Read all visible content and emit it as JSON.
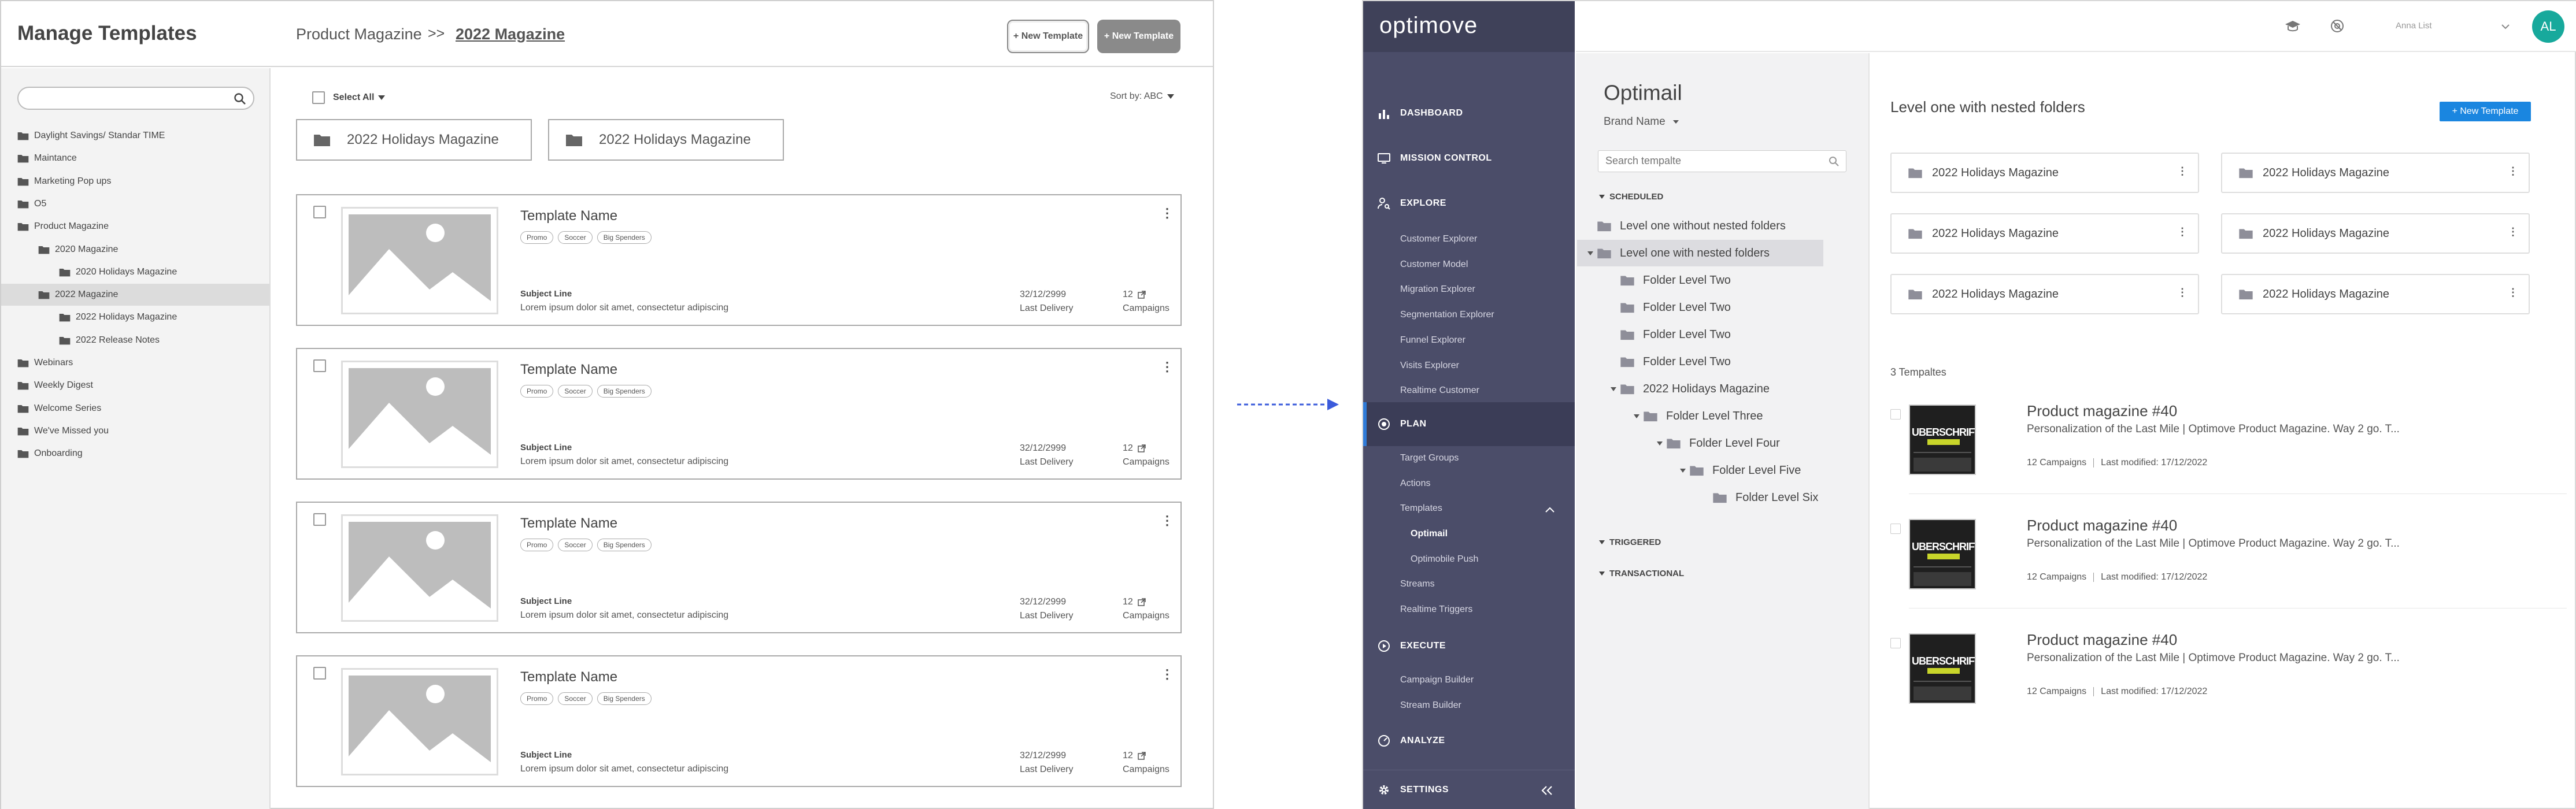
{
  "wireframe": {
    "title": "Manage Templates",
    "breadcrumb": {
      "parent": "Product Magazine",
      "separator": ">>",
      "current": "2022 Magazine"
    },
    "buttons": {
      "new_template_outline": "+ New Template",
      "new_template_filled": "+ New Template"
    },
    "tree": [
      {
        "label": "Daylight Savings/ Standar TIME"
      },
      {
        "label": "Maintance"
      },
      {
        "label": "Marketing Pop ups"
      },
      {
        "label": "O5"
      },
      {
        "label": "Product Magazine"
      },
      {
        "label": "2020 Magazine"
      },
      {
        "label": "2020 Holidays Magazine"
      },
      {
        "label": "2022 Magazine"
      },
      {
        "label": "2022 Holidays Magazine"
      },
      {
        "label": "2022 Release Notes"
      },
      {
        "label": "Webinars"
      },
      {
        "label": "Weekly Digest"
      },
      {
        "label": "Welcome Series"
      },
      {
        "label": "We've Missed you"
      },
      {
        "label": "Onboarding"
      }
    ],
    "select_all": "Select All",
    "sort_by": "Sort by: ABC",
    "folders": [
      "2022 Holidays Magazine",
      "2022 Holidays Magazine"
    ],
    "cards": [
      {
        "name": "Template Name",
        "tags": [
          "Promo",
          "Soccer",
          "Big Spenders"
        ],
        "subject_label": "Subject Line",
        "body": "Lorem ipsum dolor sit amet, consectetur adipiscing",
        "date": "32/12/2999",
        "date_label": "Last Delivery",
        "count": "12",
        "count_label": "Campaigns"
      },
      {
        "name": "Template Name",
        "tags": [
          "Promo",
          "Soccer",
          "Big Spenders"
        ],
        "subject_label": "Subject Line",
        "body": "Lorem ipsum dolor sit amet, consectetur adipiscing",
        "date": "32/12/2999",
        "date_label": "Last Delivery",
        "count": "12",
        "count_label": "Campaigns"
      },
      {
        "name": "Template Name",
        "tags": [
          "Promo",
          "Soccer",
          "Big Spenders"
        ],
        "subject_label": "Subject Line",
        "body": "Lorem ipsum dolor sit amet, consectetur adipiscing",
        "date": "32/12/2999",
        "date_label": "Last Delivery",
        "count": "12",
        "count_label": "Campaigns"
      },
      {
        "name": "Template Name",
        "tags": [
          "Promo",
          "Soccer",
          "Big Spenders"
        ],
        "subject_label": "Subject Line",
        "body": "Lorem ipsum dolor sit amet, consectetur adipiscing",
        "date": "32/12/2999",
        "date_label": "Last Delivery",
        "count": "12",
        "count_label": "Campaigns"
      }
    ]
  },
  "app": {
    "logo": "optimove",
    "user_name": "Anna List",
    "avatar_initials": "AL",
    "nav": {
      "dashboard": "DASHBOARD",
      "mission_control": "MISSION CONTROL",
      "explore": "EXPLORE",
      "explore_items": [
        "Customer Explorer",
        "Customer Model",
        "Migration Explorer",
        "Segmentation Explorer",
        "Funnel Explorer",
        "Visits Explorer",
        "Realtime Customer"
      ],
      "plan": "PLAN",
      "plan_items": [
        "Target Groups",
        "Actions",
        "Templates"
      ],
      "templates_sub": [
        "Optimail",
        "Optimobile Push"
      ],
      "plan_items_after": [
        "Streams",
        "Realtime Triggers"
      ],
      "execute": "EXECUTE",
      "execute_items": [
        "Campaign Builder",
        "Stream Builder"
      ],
      "analyze": "ANALYZE",
      "settings": "SETTINGS"
    },
    "panel": {
      "title": "Optimail",
      "brand": "Brand Name",
      "search_placeholder": "Search tempalte",
      "scheduled": "SCHEDULED",
      "triggered": "TRIGGERED",
      "transactional": "TRANSACTIONAL",
      "tree": [
        {
          "label": "Level one without nested folders"
        },
        {
          "label": "Level one with nested folders"
        },
        {
          "label": "Folder Level Two"
        },
        {
          "label": "Folder Level Two"
        },
        {
          "label": "Folder Level Two"
        },
        {
          "label": "Folder Level Two"
        },
        {
          "label": "2022 Holidays Magazine"
        },
        {
          "label": "Folder Level Three"
        },
        {
          "label": "Folder Level Four"
        },
        {
          "label": "Folder Level Five"
        },
        {
          "label": "Folder Level Six"
        }
      ]
    },
    "main": {
      "title": "Level one with nested folders",
      "new_button": "+ New Template",
      "folders": [
        "2022 Holidays Magazine",
        "2022 Holidays Magazine",
        "2022 Holidays Magazine",
        "2022 Holidays Magazine",
        "2022 Holidays Magazine",
        "2022 Holidays Magazine"
      ],
      "count_label": "3 Tempaltes",
      "templates": [
        {
          "name": "Product magazine #40",
          "desc": "Personalization of the Last Mile | Optimove Product Magazine. Way 2 go. T...",
          "campaigns": "12 Campaigns",
          "modified": "Last modified: 17/12/2022",
          "thumb_text": "UBERSCHRIFT"
        },
        {
          "name": "Product magazine #40",
          "desc": "Personalization of the Last Mile | Optimove Product Magazine. Way 2 go. T...",
          "campaigns": "12 Campaigns",
          "modified": "Last modified: 17/12/2022",
          "thumb_text": "UBERSCHRIFT"
        },
        {
          "name": "Product magazine #40",
          "desc": "Personalization of the Last Mile | Optimove Product Magazine. Way 2 go. T...",
          "campaigns": "12 Campaigns",
          "modified": "Last modified: 17/12/2022",
          "thumb_text": "UBERSCHRIFT"
        }
      ]
    }
  },
  "colors": {
    "nav_bg": "#4b4d69",
    "accent": "#1a86e0",
    "avatar": "#17a99c",
    "arrow": "#3b5bdb"
  }
}
